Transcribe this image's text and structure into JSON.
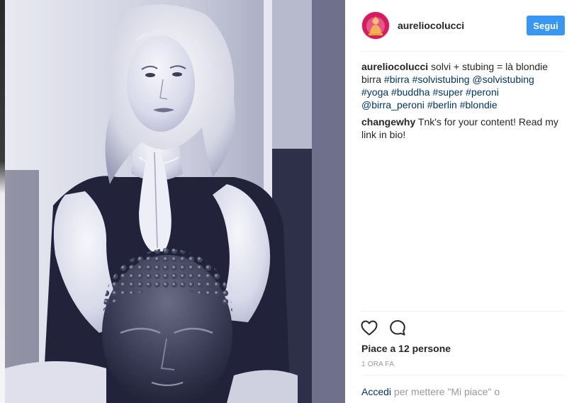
{
  "post": {
    "author": "aureliocolucci",
    "follow_label": "Segui",
    "likes_text": "Piace a 12 persone",
    "time_text": "1 ORA FA"
  },
  "caption": {
    "user": "aureliocolucci",
    "text": "solvi + stubing = là blondie birra",
    "tags": [
      "#birra",
      "#solvistubing",
      "@solvistubing",
      "#yoga",
      "#buddha",
      "#super",
      "#peroni",
      "@birra_peroni",
      "#berlin",
      "#blondie"
    ]
  },
  "comment": {
    "user": "changewhy",
    "text": "Tnk's for your content! Read my link in bio!"
  },
  "login": {
    "link": "Accedi",
    "rest": "per mettere \"Mi piace\" o"
  },
  "icons": {
    "like": "heart-outline-icon",
    "comment": "speech-bubble-icon",
    "avatar": "buddha-statue-avatar"
  },
  "colors": {
    "accent": "#3897f0",
    "link": "#003569",
    "text": "#262626",
    "muted": "#999999",
    "photo_tint": "#2b2d55"
  }
}
